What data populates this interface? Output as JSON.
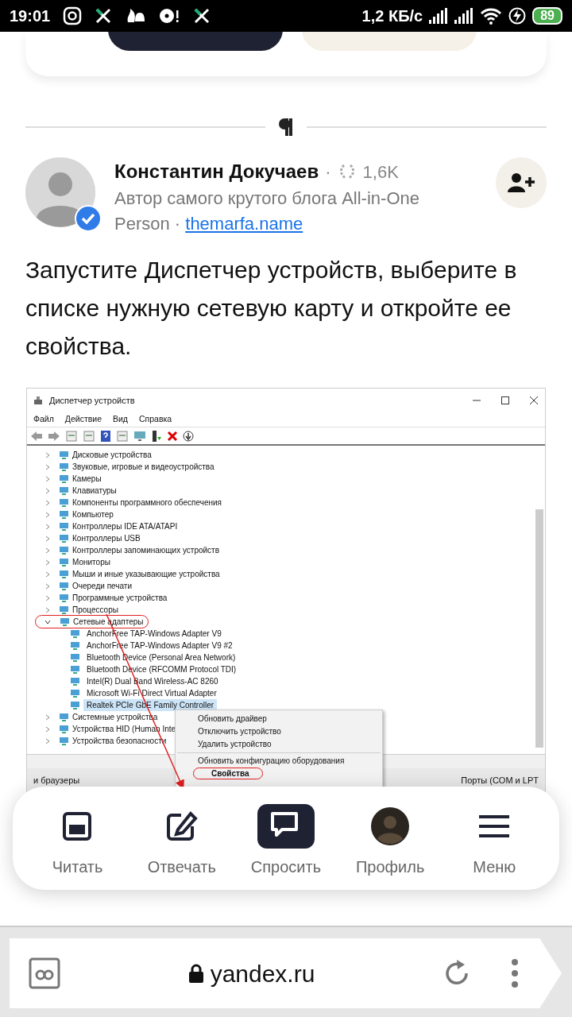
{
  "status_bar": {
    "time": "19:01",
    "speed": "1,2 КБ/с",
    "battery": "89"
  },
  "author": {
    "name": "Константин Докучаев",
    "separator": "·",
    "rating": "1,6K",
    "verified": true,
    "bio": "Автор самого крутого блога All-in-One Person",
    "bio_separator": "·",
    "site": "themarfa.name"
  },
  "paragraph": "Запустите Диспетчер устройств, выберите в списке нужную сетевую карту и откройте ее свойства.",
  "screenshot": {
    "title": "Диспетчер устройств",
    "menu": [
      "Файл",
      "Действие",
      "Вид",
      "Справка"
    ],
    "tree": [
      {
        "label": "Дисковые устройства",
        "expanded": false,
        "highlighted": false
      },
      {
        "label": "Звуковые, игровые и видеоустройства",
        "expanded": false,
        "highlighted": false
      },
      {
        "label": "Камеры",
        "expanded": false,
        "highlighted": false
      },
      {
        "label": "Клавиатуры",
        "expanded": false,
        "highlighted": false
      },
      {
        "label": "Компоненты программного обеспечения",
        "expanded": false,
        "highlighted": false
      },
      {
        "label": "Компьютер",
        "expanded": false,
        "highlighted": false
      },
      {
        "label": "Контроллеры IDE ATA/ATAPI",
        "expanded": false,
        "highlighted": false
      },
      {
        "label": "Контроллеры USB",
        "expanded": false,
        "highlighted": false
      },
      {
        "label": "Контроллеры запоминающих устройств",
        "expanded": false,
        "highlighted": false
      },
      {
        "label": "Мониторы",
        "expanded": false,
        "highlighted": false
      },
      {
        "label": "Мыши и иные указывающие устройства",
        "expanded": false,
        "highlighted": false
      },
      {
        "label": "Очереди печати",
        "expanded": false,
        "highlighted": false
      },
      {
        "label": "Программные устройства",
        "expanded": false,
        "highlighted": false
      },
      {
        "label": "Процессоры",
        "expanded": false,
        "highlighted": false
      },
      {
        "label": "Сетевые адаптеры",
        "expanded": true,
        "highlighted": true,
        "children": [
          {
            "label": "AnchorFree TAP-Windows Adapter V9",
            "selected": false
          },
          {
            "label": "AnchorFree TAP-Windows Adapter V9 #2",
            "selected": false
          },
          {
            "label": "Bluetooth Device (Personal Area Network)",
            "selected": false
          },
          {
            "label": "Bluetooth Device (RFCOMM Protocol TDI)",
            "selected": false
          },
          {
            "label": "Intel(R) Dual Band Wireless-AC 8260",
            "selected": false
          },
          {
            "label": "Microsoft Wi-Fi Direct Virtual Adapter",
            "selected": false
          },
          {
            "label": "Realtek PCIe GbE Family Controller",
            "selected": true
          }
        ]
      },
      {
        "label": "Системные устройства",
        "expanded": false,
        "highlighted": false
      },
      {
        "label": "Устройства HID (Human Inte",
        "expanded": false,
        "highlighted": false
      },
      {
        "label": "Устройства безопасности",
        "expanded": false,
        "highlighted": false
      }
    ],
    "context_menu": [
      {
        "label": "Обновить драйвер",
        "kind": "item",
        "highlighted": false
      },
      {
        "label": "Отключить устройство",
        "kind": "item",
        "highlighted": false
      },
      {
        "label": "Удалить устройство",
        "kind": "item",
        "highlighted": false
      },
      {
        "kind": "separator"
      },
      {
        "label": "Обновить конфигурацию оборудования",
        "kind": "item",
        "highlighted": false
      },
      {
        "label": "Свойства",
        "kind": "bold",
        "highlighted": true
      }
    ],
    "background_left": "и браузеры",
    "background_right": "Порты (COM и LPT"
  },
  "bottom_nav": [
    {
      "label": "Читать",
      "kind": "reader",
      "selected": false
    },
    {
      "label": "Отвечать",
      "kind": "pencil",
      "selected": false
    },
    {
      "label": "Спросить",
      "kind": "chat",
      "selected": true
    },
    {
      "label": "Профиль",
      "selected": false
    },
    {
      "label": "Меню",
      "kind": "menu",
      "selected": false
    }
  ],
  "browser": {
    "url": "yandex.ru"
  }
}
